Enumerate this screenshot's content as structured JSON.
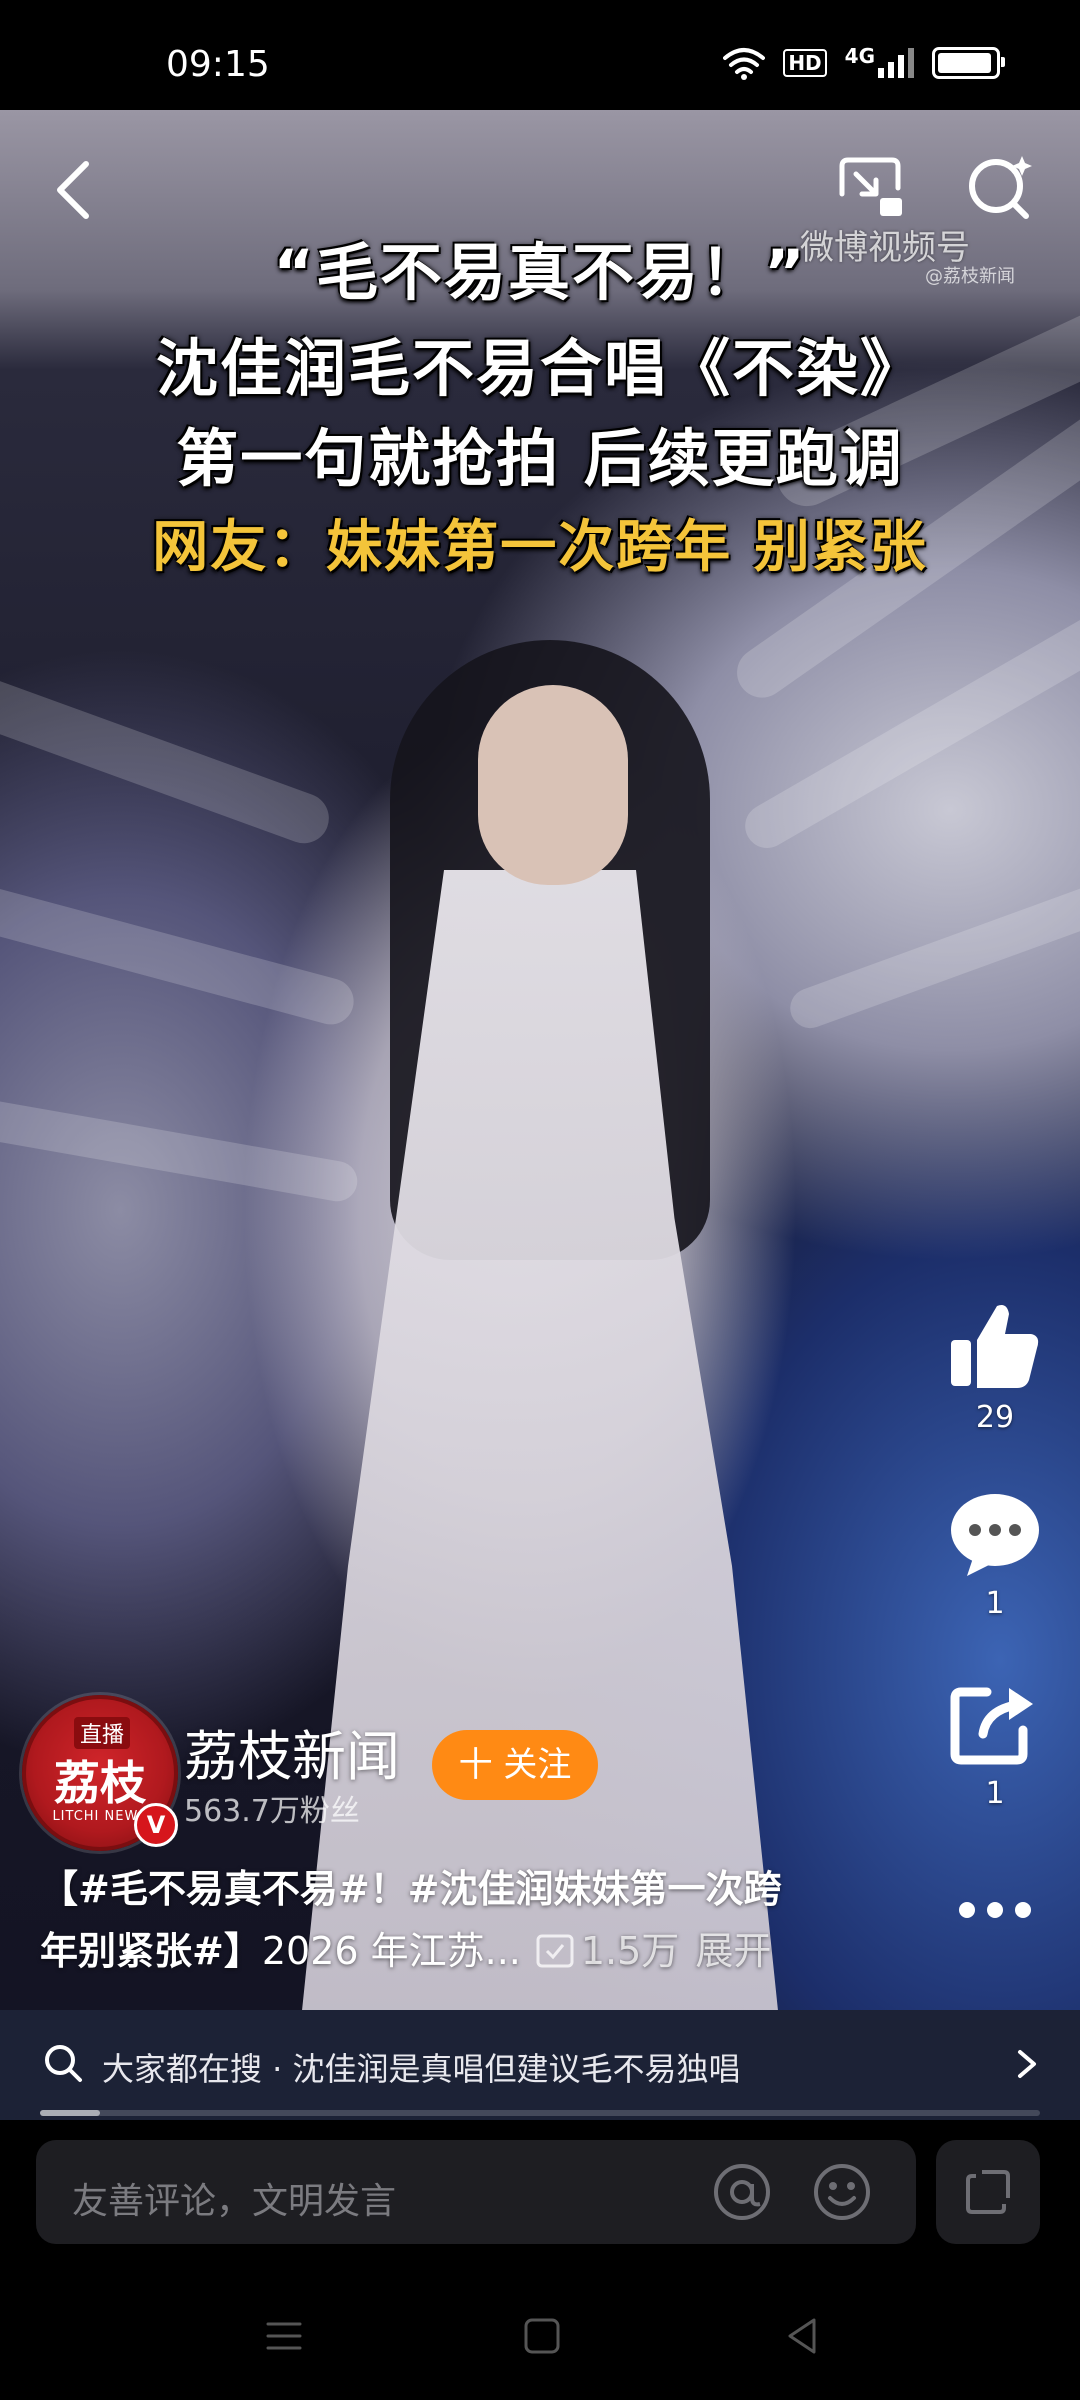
{
  "status_bar": {
    "time": "09:15",
    "hd_label": "HD",
    "network_label": "4G",
    "battery_level": 0.95
  },
  "video": {
    "captions": [
      "“毛不易真不易！”",
      "沈佳润毛不易合唱《不染》",
      "第一句就抢拍  后续更跑调",
      "网友：妹妹第一次跨年 别紧张"
    ],
    "watermark": "微博视频号",
    "watermark_sub": "@荔枝新闻"
  },
  "actions": {
    "like_count": "29",
    "comment_count": "1",
    "share_count": "1"
  },
  "author": {
    "avatar_live": "直播",
    "avatar_logo": "荔枝",
    "avatar_en": "LITCHI NEWS",
    "verified": "V",
    "name": "荔枝新闻",
    "fans": "563.7万粉丝",
    "follow_label": "十 关注"
  },
  "description": {
    "line1": "【#毛不易真不易#！#沈佳润妹妹第一次跨",
    "line2_bold": "年别紧张#】",
    "line2_rest": "2026 年江苏...",
    "views": "1.5万",
    "expand": "展开"
  },
  "search_suggestion": {
    "text": "大家都在搜 · 沈佳润是真唱但建议毛不易独唱",
    "progress": 0.06
  },
  "comment_bar": {
    "placeholder": "友善评论，文明发言"
  },
  "colors": {
    "accent": "#ff8a14",
    "caption_highlight": "#f4c43a",
    "suggest_bg": "#1c2236"
  }
}
